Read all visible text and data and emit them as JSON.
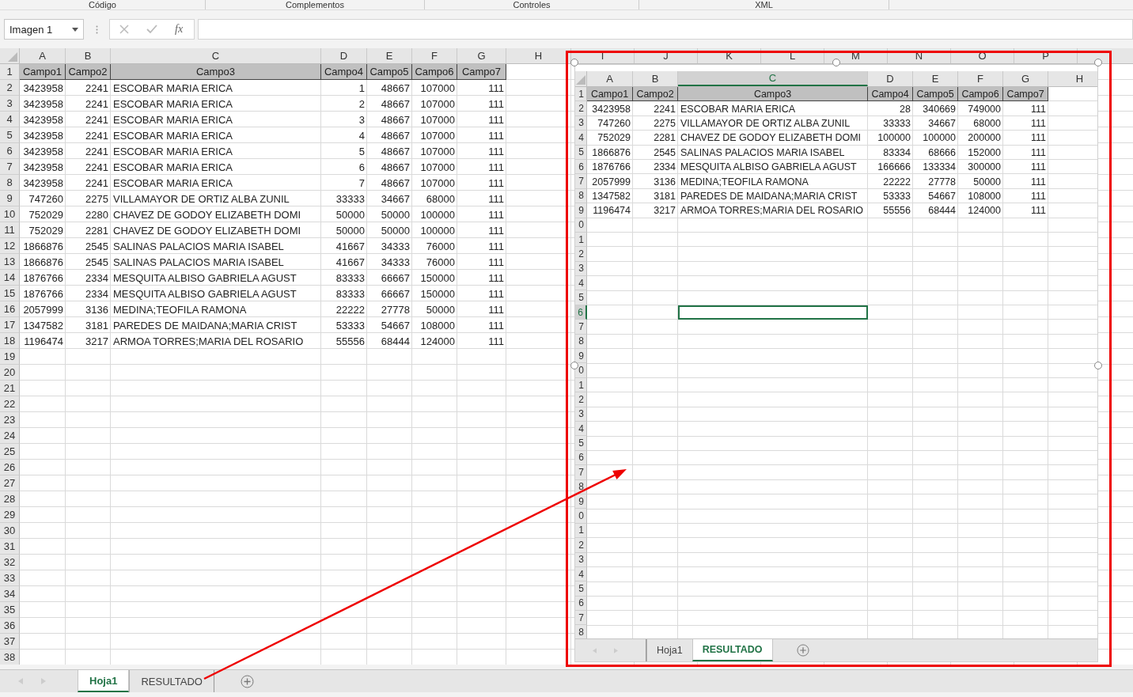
{
  "ribbon_groups": [
    {
      "label": "Código"
    },
    {
      "label": "Complementos"
    },
    {
      "label": "Controles"
    },
    {
      "label": "XML"
    }
  ],
  "name_box": {
    "value": "Imagen 1"
  },
  "formula_bar": {
    "function_label": "fx"
  },
  "sheet": {
    "columns": [
      "A",
      "B",
      "C",
      "D",
      "E",
      "F",
      "G",
      "H",
      "I",
      "J",
      "K",
      "L",
      "M",
      "N",
      "O",
      "P"
    ],
    "header": [
      "Campo1",
      "Campo2",
      "Campo3",
      "Campo4",
      "Campo5",
      "Campo6",
      "Campo7"
    ],
    "rows": [
      [
        "3423958",
        "2241",
        "ESCOBAR MARIA ERICA",
        "1",
        "48667",
        "107000",
        "111"
      ],
      [
        "3423958",
        "2241",
        "ESCOBAR MARIA ERICA",
        "2",
        "48667",
        "107000",
        "111"
      ],
      [
        "3423958",
        "2241",
        "ESCOBAR MARIA ERICA",
        "3",
        "48667",
        "107000",
        "111"
      ],
      [
        "3423958",
        "2241",
        "ESCOBAR MARIA ERICA",
        "4",
        "48667",
        "107000",
        "111"
      ],
      [
        "3423958",
        "2241",
        "ESCOBAR MARIA ERICA",
        "5",
        "48667",
        "107000",
        "111"
      ],
      [
        "3423958",
        "2241",
        "ESCOBAR MARIA ERICA",
        "6",
        "48667",
        "107000",
        "111"
      ],
      [
        "3423958",
        "2241",
        "ESCOBAR MARIA ERICA",
        "7",
        "48667",
        "107000",
        "111"
      ],
      [
        "747260",
        "2275",
        "VILLAMAYOR DE ORTIZ ALBA ZUNIL",
        "33333",
        "34667",
        "68000",
        "111"
      ],
      [
        "752029",
        "2280",
        "CHAVEZ DE GODOY ELIZABETH DOMI",
        "50000",
        "50000",
        "100000",
        "111"
      ],
      [
        "752029",
        "2281",
        "CHAVEZ DE GODOY ELIZABETH DOMI",
        "50000",
        "50000",
        "100000",
        "111"
      ],
      [
        "1866876",
        "2545",
        "SALINAS PALACIOS MARIA ISABEL",
        "41667",
        "34333",
        "76000",
        "111"
      ],
      [
        "1866876",
        "2545",
        "SALINAS PALACIOS MARIA ISABEL",
        "41667",
        "34333",
        "76000",
        "111"
      ],
      [
        "1876766",
        "2334",
        "MESQUITA ALBISO GABRIELA AGUST",
        "83333",
        "66667",
        "150000",
        "111"
      ],
      [
        "1876766",
        "2334",
        "MESQUITA ALBISO GABRIELA AGUST",
        "83333",
        "66667",
        "150000",
        "111"
      ],
      [
        "2057999",
        "3136",
        "MEDINA;TEOFILA RAMONA",
        "22222",
        "27778",
        "50000",
        "111"
      ],
      [
        "1347582",
        "3181",
        "PAREDES DE MAIDANA;MARIA CRIST",
        "53333",
        "54667",
        "108000",
        "111"
      ],
      [
        "1196474",
        "3217",
        "ARMOA TORRES;MARIA DEL ROSARIO",
        "55556",
        "68444",
        "124000",
        "111"
      ]
    ],
    "row_numbers": [
      "1",
      "2",
      "3",
      "4",
      "5",
      "6",
      "7",
      "8",
      "9",
      "10",
      "11",
      "12",
      "13",
      "14",
      "15",
      "16",
      "17",
      "18",
      "19",
      "20",
      "21",
      "22",
      "23",
      "24",
      "25",
      "26",
      "27",
      "28",
      "29",
      "30",
      "31",
      "32",
      "33",
      "34",
      "35",
      "36",
      "37",
      "38"
    ]
  },
  "sheet_tabs": [
    {
      "label": "Hoja1",
      "selected": true
    },
    {
      "label": "RESULTADO",
      "selected": false
    }
  ],
  "embedded_screenshot": {
    "columns": [
      {
        "label": "A",
        "selected": false
      },
      {
        "label": "B",
        "selected": false
      },
      {
        "label": "C",
        "selected": true
      },
      {
        "label": "D",
        "selected": false
      },
      {
        "label": "E",
        "selected": false
      },
      {
        "label": "F",
        "selected": false
      },
      {
        "label": "G",
        "selected": false
      },
      {
        "label": "H",
        "selected": false
      }
    ],
    "header": [
      "Campo1",
      "Campo2",
      "Campo3",
      "Campo4",
      "Campo5",
      "Campo6",
      "Campo7"
    ],
    "rows": [
      [
        "3423958",
        "2241",
        "ESCOBAR MARIA ERICA",
        "28",
        "340669",
        "749000",
        "111"
      ],
      [
        "747260",
        "2275",
        "VILLAMAYOR DE ORTIZ ALBA ZUNIL",
        "33333",
        "34667",
        "68000",
        "111"
      ],
      [
        "752029",
        "2281",
        "CHAVEZ DE GODOY ELIZABETH DOMI",
        "100000",
        "100000",
        "200000",
        "111"
      ],
      [
        "1866876",
        "2545",
        "SALINAS PALACIOS MARIA ISABEL",
        "83334",
        "68666",
        "152000",
        "111"
      ],
      [
        "1876766",
        "2334",
        "MESQUITA ALBISO GABRIELA AGUST",
        "166666",
        "133334",
        "300000",
        "111"
      ],
      [
        "2057999",
        "3136",
        "MEDINA;TEOFILA RAMONA",
        "22222",
        "27778",
        "50000",
        "111"
      ],
      [
        "1347582",
        "3181",
        "PAREDES DE MAIDANA;MARIA CRIST",
        "53333",
        "54667",
        "108000",
        "111"
      ],
      [
        "1196474",
        "3217",
        "ARMOA TORRES;MARIA DEL ROSARIO",
        "55556",
        "68444",
        "124000",
        "111"
      ]
    ],
    "row_numbers": [
      {
        "label": "1",
        "selected": false
      },
      {
        "label": "2",
        "selected": false
      },
      {
        "label": "3",
        "selected": false
      },
      {
        "label": "4",
        "selected": false
      },
      {
        "label": "5",
        "selected": false
      },
      {
        "label": "6",
        "selected": false
      },
      {
        "label": "7",
        "selected": false
      },
      {
        "label": "8",
        "selected": false
      },
      {
        "label": "9",
        "selected": false
      },
      {
        "label": "0",
        "selected": false
      },
      {
        "label": "1",
        "selected": false
      },
      {
        "label": "2",
        "selected": false
      },
      {
        "label": "3",
        "selected": false
      },
      {
        "label": "4",
        "selected": false
      },
      {
        "label": "5",
        "selected": false
      },
      {
        "label": "6",
        "selected": true
      },
      {
        "label": "7",
        "selected": false
      },
      {
        "label": "8",
        "selected": false
      },
      {
        "label": "9",
        "selected": false
      },
      {
        "label": "0",
        "selected": false
      },
      {
        "label": "1",
        "selected": false
      },
      {
        "label": "2",
        "selected": false
      },
      {
        "label": "3",
        "selected": false
      },
      {
        "label": "4",
        "selected": false
      },
      {
        "label": "5",
        "selected": false
      },
      {
        "label": "6",
        "selected": false
      },
      {
        "label": "7",
        "selected": false
      },
      {
        "label": "8",
        "selected": false
      },
      {
        "label": "9",
        "selected": false
      },
      {
        "label": "0",
        "selected": false
      },
      {
        "label": "1",
        "selected": false
      },
      {
        "label": "2",
        "selected": false
      },
      {
        "label": "3",
        "selected": false
      },
      {
        "label": "4",
        "selected": false
      },
      {
        "label": "5",
        "selected": false
      },
      {
        "label": "6",
        "selected": false
      },
      {
        "label": "7",
        "selected": false
      },
      {
        "label": "8",
        "selected": false
      }
    ],
    "sheet_tabs": [
      {
        "label": "Hoja1",
        "selected": false
      },
      {
        "label": "RESULTADO",
        "selected": true
      }
    ]
  }
}
